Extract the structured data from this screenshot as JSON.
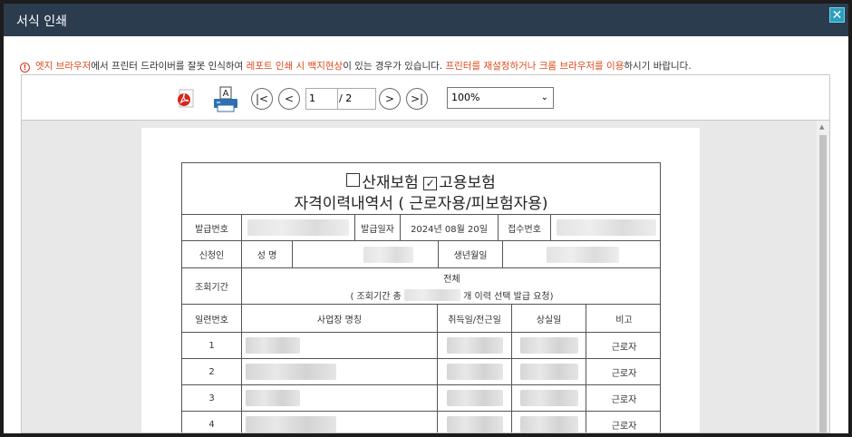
{
  "window": {
    "title": "서식 인쇄",
    "close_symbol": "✕"
  },
  "notice": {
    "seg1": "엣지 브라우저",
    "seg2": "에서 프린터 드라이버를 잘못 인식하여 ",
    "seg3": "레포트 인쇄 시 백지현상",
    "seg4": "이 있는 경우가 있습니다. ",
    "seg5": "프린터를 재설정하거나 크롬 브라우저를 이용",
    "seg6": "하시기 바랍니다."
  },
  "toolbar": {
    "first_symbol": "|<",
    "prev_symbol": "<",
    "next_symbol": ">",
    "last_symbol": ">|",
    "page_value": "1",
    "page_total": "/ 2",
    "zoom_value": "100%"
  },
  "document": {
    "title_opt1": "산재보험",
    "title_opt2": "고용보험",
    "title_line2": "자격이력내역서 ( 근로자용/피보험자용)",
    "issue_no_label": "발급번호",
    "issue_date_label": "발급일자",
    "issue_date_value": "2024년 08월 20일",
    "receipt_no_label": "접수번호",
    "applicant_label": "신청인",
    "name_label": "성 명",
    "birth_label": "생년월일",
    "period_label": "조회기간",
    "period_value": "전체",
    "period_note_pre": "( 조회기간 총",
    "period_note_post": "개 이력 선택 발급 요청)",
    "headers": {
      "seq": "일련번호",
      "workplace": "사업장 명칭",
      "acquired": "취득일/전근일",
      "lost": "상실일",
      "note": "비고"
    },
    "rows": [
      {
        "seq": "1",
        "note": "근로자"
      },
      {
        "seq": "2",
        "note": "근로자"
      },
      {
        "seq": "3",
        "note": "근로자"
      },
      {
        "seq": "4",
        "note": "근로자"
      }
    ]
  }
}
